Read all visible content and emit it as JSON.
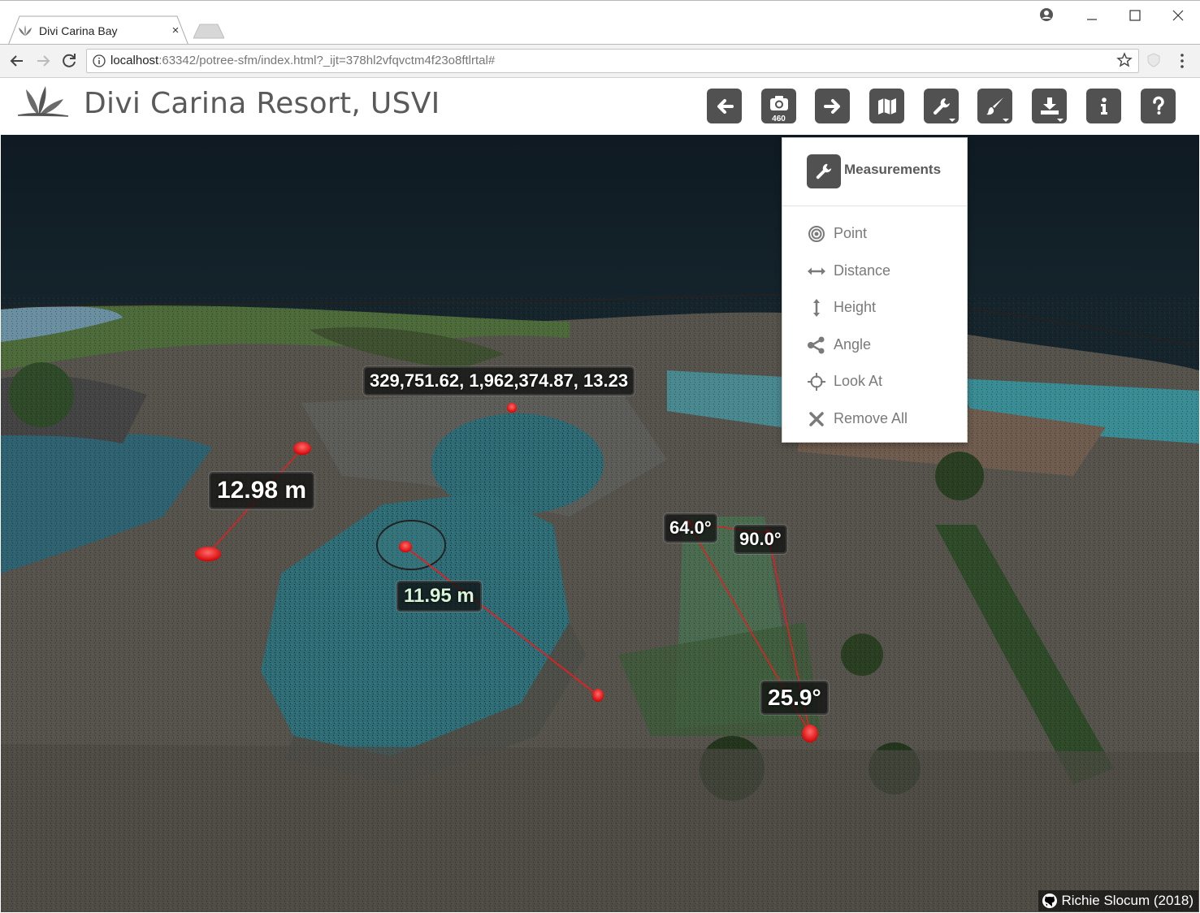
{
  "browser": {
    "tab_title": "Divi Carina Bay",
    "tab_close": "×",
    "url_host": "localhost",
    "url_rest": ":63342/potree-sfm/index.html?_ijt=378hl2vfqvctm4f23o8ftlrtal#"
  },
  "app": {
    "title": "Divi Carina Resort, USVI",
    "camera_count": "460",
    "toolbar_icons": [
      "arrow-left-icon",
      "camera-icon",
      "arrow-right-icon",
      "map-icon",
      "wrench-icon",
      "brush-icon",
      "download-icon",
      "info-icon",
      "help-icon"
    ]
  },
  "measurements_menu": {
    "title": "Measurements",
    "items": [
      {
        "label": "Point",
        "icon": "target-icon"
      },
      {
        "label": "Distance",
        "icon": "horizontal-arrows-icon"
      },
      {
        "label": "Height",
        "icon": "vertical-arrows-icon"
      },
      {
        "label": "Angle",
        "icon": "share-nodes-icon"
      },
      {
        "label": "Look At",
        "icon": "crosshair-icon"
      },
      {
        "label": "Remove All",
        "icon": "x-icon"
      }
    ]
  },
  "scene_labels": {
    "coordinate": "329,751.62, 1,962,374.87, 13.23",
    "distance_1": "12.98 m",
    "distance_2": "11.95 m",
    "angle_1": "64.0°",
    "angle_2": "90.0°",
    "angle_3": "25.9°"
  },
  "credit": "Richie Slocum (2018)",
  "colors": {
    "button_bg": "#515151",
    "marker": "#ff1a1a",
    "title_text": "#5a5a5a"
  }
}
